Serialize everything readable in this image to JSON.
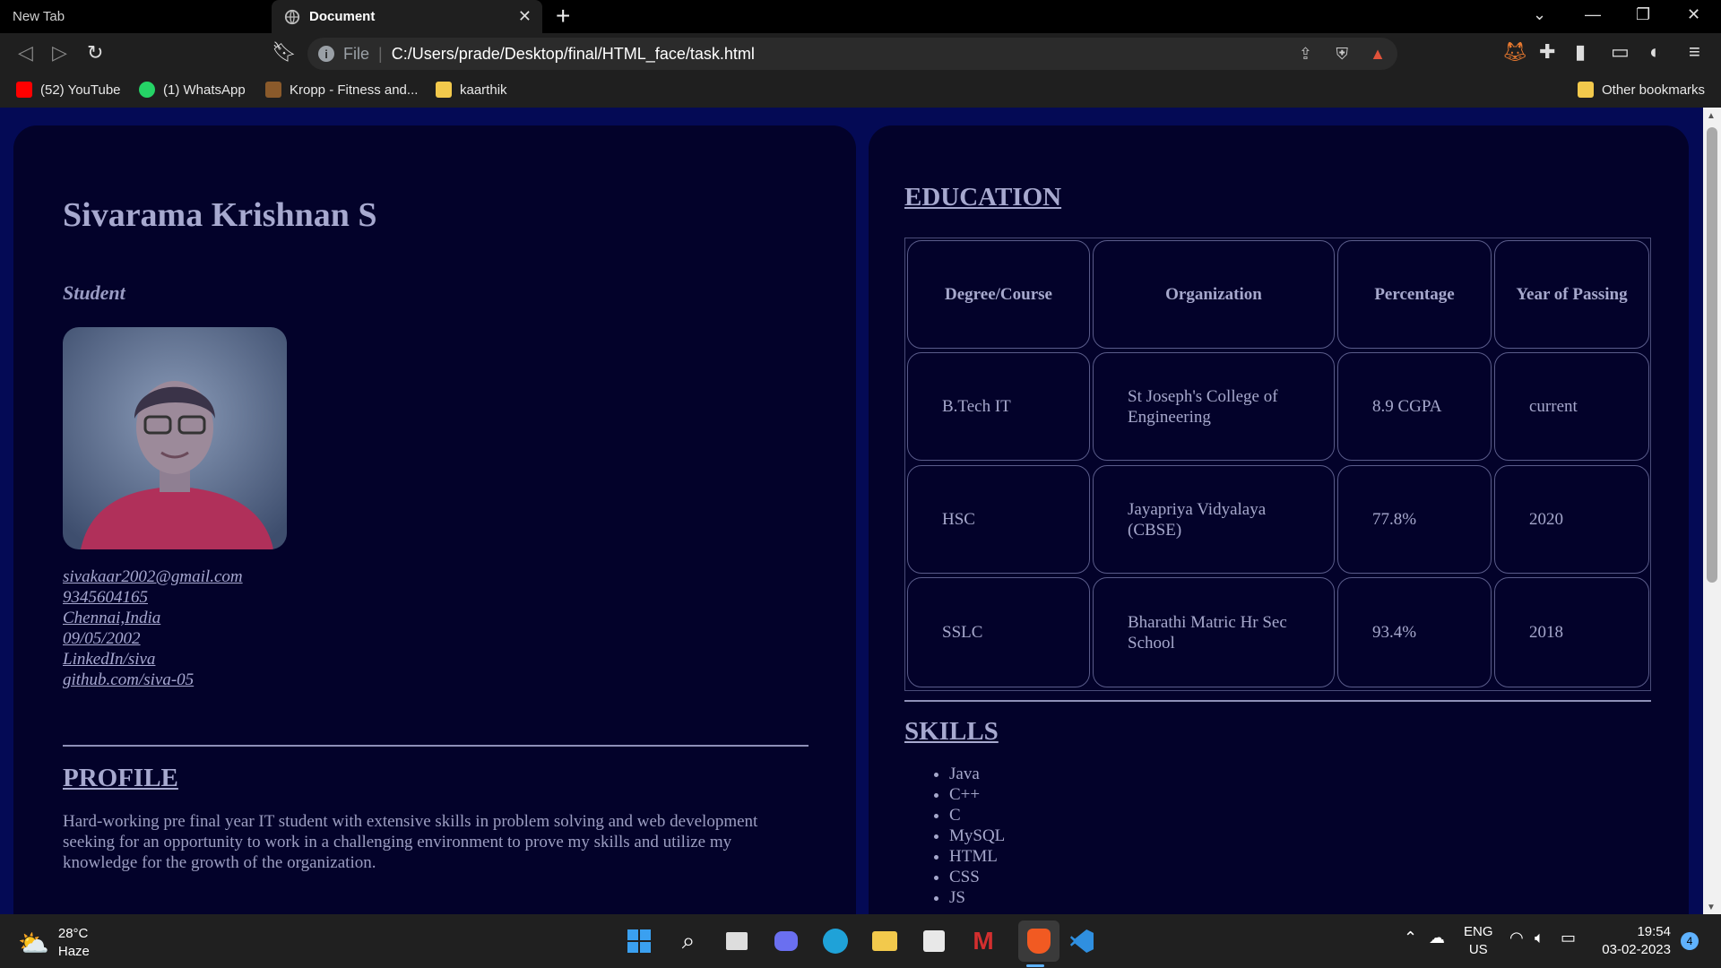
{
  "browser": {
    "tabs": [
      {
        "label": "New Tab",
        "active": false
      },
      {
        "label": "Document",
        "active": true
      }
    ],
    "address": {
      "scheme": "File",
      "url": "C:/Users/prade/Desktop/final/HTML_face/task.html"
    },
    "bookmarks": [
      {
        "label": "(52) YouTube",
        "icon": "youtube-icon",
        "color": "#ff0000"
      },
      {
        "label": "(1) WhatsApp",
        "icon": "whatsapp-icon",
        "color": "#25d366"
      },
      {
        "label": "Kropp - Fitness and...",
        "icon": "kropp-icon",
        "color": "#8a5a2b"
      },
      {
        "label": "kaarthik",
        "icon": "folder-icon",
        "color": "#f2c94c"
      }
    ],
    "other_bookmarks": "Other bookmarks"
  },
  "profile": {
    "name": "Sivarama Krishnan S",
    "role": "Student",
    "contacts": [
      "sivakaar2002@gmail.com",
      "9345604165",
      "Chennai,India",
      "09/05/2002",
      "LinkedIn/siva",
      "github.com/siva-05"
    ],
    "profile_title": "PROFILE",
    "profile_text": "Hard-working pre final year IT student with extensive skills in problem solving and web development seeking for an opportunity to work in a challenging environment to prove my skills and utilize my knowledge for the growth of the organization."
  },
  "education": {
    "title": "EDUCATION",
    "headers": [
      "Degree/Course",
      "Organization",
      "Percentage",
      "Year of Passing"
    ],
    "rows": [
      [
        "B.Tech IT",
        "St Joseph's College of Engineering",
        "8.9 CGPA",
        "current"
      ],
      [
        "HSC",
        "Jayapriya Vidyalaya (CBSE)",
        "77.8%",
        "2020"
      ],
      [
        "SSLC",
        "Bharathi Matric Hr Sec School",
        "93.4%",
        "2018"
      ]
    ]
  },
  "skills": {
    "title": "SKILLS",
    "items": [
      "Java",
      "C++",
      "C",
      "MySQL",
      "HTML",
      "CSS",
      "JS"
    ]
  },
  "taskbar": {
    "weather": {
      "temp": "28°C",
      "condition": "Haze"
    },
    "lang": {
      "line1": "ENG",
      "line2": "US"
    },
    "time": "19:54",
    "date": "03-02-2023",
    "notifications": "4"
  },
  "colors": {
    "page_bg": "#040a55",
    "card_bg": "#03022a",
    "text": "#a7a9cf"
  }
}
